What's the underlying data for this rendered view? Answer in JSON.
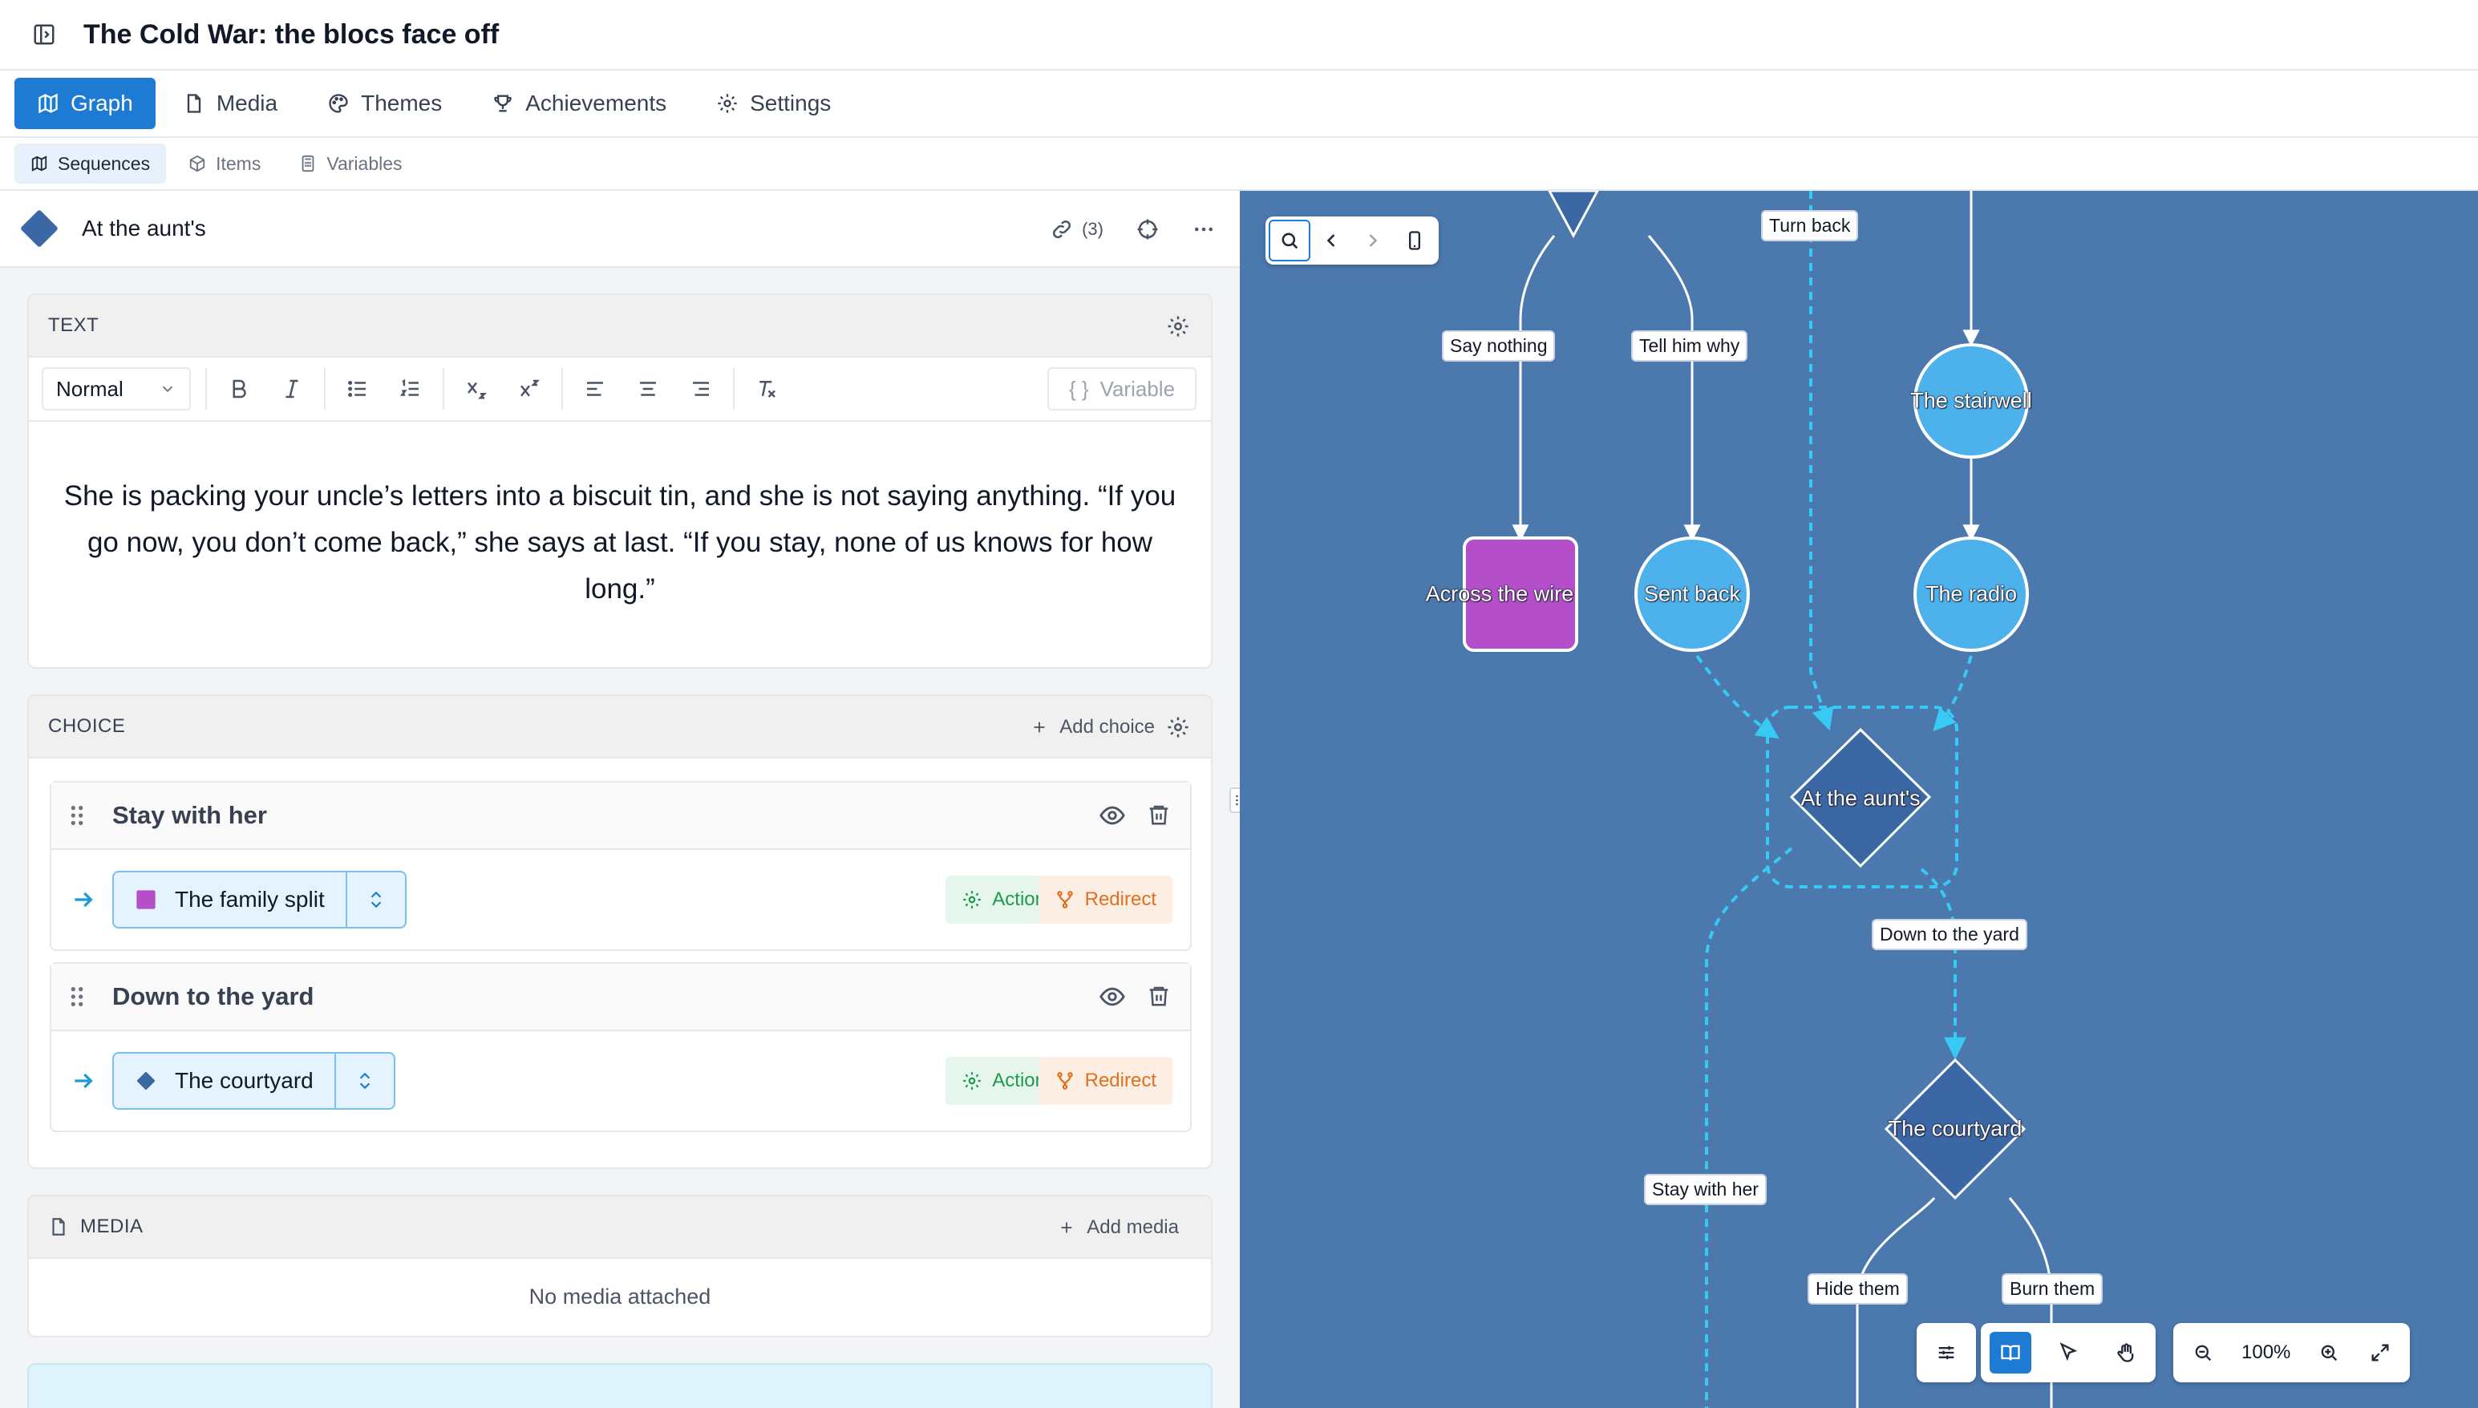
{
  "window": {
    "title": "The Cold War: the blocs face off"
  },
  "tabs": [
    {
      "label": "Graph",
      "active": true
    },
    {
      "label": "Media"
    },
    {
      "label": "Themes"
    },
    {
      "label": "Achievements"
    },
    {
      "label": "Settings"
    }
  ],
  "subtabs": [
    {
      "label": "Sequences",
      "active": true
    },
    {
      "label": "Items"
    },
    {
      "label": "Variables"
    }
  ],
  "node": {
    "name": "At the aunt's",
    "links_count": "(3)"
  },
  "text_section": {
    "heading": "TEXT",
    "format_value": "Normal",
    "variable_label": "Variable",
    "body": "She is packing your uncle’s letters into a biscuit tin, and she is not saying anything. “If you go now, you don’t come back,” she says at last. “If you stay, none of us knows for how long.”"
  },
  "choice_section": {
    "heading": "CHOICE",
    "add_label": "Add choice",
    "choices": [
      {
        "label": "Stay with her",
        "target": "The family split",
        "target_color": "#b44fc9",
        "action_label": "Action",
        "redirect_label": "Redirect"
      },
      {
        "label": "Down to the yard",
        "target": "The courtyard",
        "target_color": "#3b67a5",
        "action_label": "Action",
        "redirect_label": "Redirect"
      }
    ]
  },
  "media_section": {
    "heading": "MEDIA",
    "add_label": "Add media",
    "empty": "No media attached"
  },
  "graph": {
    "edge_labels": {
      "say_nothing": "Say nothing",
      "tell_him_why": "Tell him why",
      "turn_back": "Turn back",
      "down_to_yard": "Down to the yard",
      "stay_with_her": "Stay with her",
      "hide_them": "Hide them",
      "burn_them": "Burn them"
    },
    "nodes": {
      "across_the_wire": "Across the wire",
      "sent_back": "Sent back",
      "the_stairwell": "The stairwell",
      "the_radio": "The radio",
      "at_the_aunts": "At the aunt's",
      "the_courtyard": "The courtyard"
    },
    "zoom": "100%",
    "colors": {
      "background": "#4b78ad",
      "circle": "#4db1ec",
      "square": "#b44fc9",
      "diamond": "#3b67a5",
      "dashed": "#38c9f5"
    }
  }
}
